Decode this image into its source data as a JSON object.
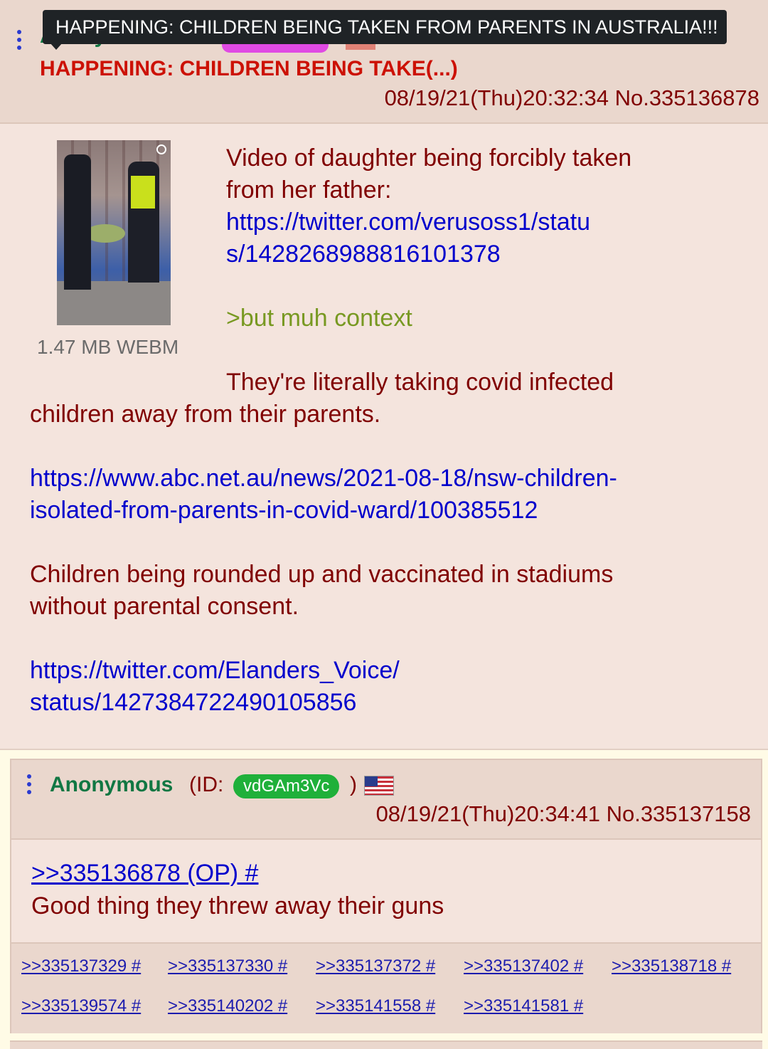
{
  "tooltip": {
    "text": "HAPPENING: CHILDREN BEING TAKEN FROM PARENTS IN AUSTRALIA!!!"
  },
  "op": {
    "name": "Anonymous",
    "subject": "HAPPENING: CHILDREN BEING TAKE(...)",
    "datetime": "08/19/21(Thu)20:32:34 No.335136878",
    "file_info": "1.47 MB WEBM",
    "body": {
      "line1": "Video of daughter being forcibly taken",
      "line2": "from her father:",
      "link1_a": "https://twitter.com/verusoss1/statu",
      "link1_b": "s/1428268988816101378",
      "greentext": ">but muh context",
      "line3": "They're literally taking covid infected",
      "line4": "children away from their parents.",
      "link2_a": "https://www.abc.net.au/news/2021-08-18/nsw-children-",
      "link2_b": "isolated-from-parents-in-covid-ward/100385512",
      "line5": "Children being rounded up and vaccinated in stadiums",
      "line6": "without parental consent.",
      "link3_a": "https://twitter.com/Elanders_Voice/",
      "link3_b": "status/1427384722490105856"
    }
  },
  "reply": {
    "name": "Anonymous",
    "id_label": "(ID:",
    "id": "vdGAm3Vc",
    "id_close": ")",
    "datetime": "08/19/21(Thu)20:34:41 No.335137158",
    "quote": ">>335136878 (OP) #",
    "text": "Good thing they threw away their guns",
    "backlinks": [
      ">>335137329 #",
      ">>335137330 #",
      ">>335137372 #",
      ">>335137402 #",
      ">>335138718 #",
      ">>335139574 #",
      ">>335140202 #",
      ">>335141558 #",
      ">>335141581 #"
    ]
  },
  "colors": {
    "name_green": "#117743",
    "subject_red": "#cc1105",
    "text_maroon": "#800000",
    "link_blue": "#0000cc",
    "greentext": "#789922",
    "id_pill_green": "#1fb03a"
  }
}
